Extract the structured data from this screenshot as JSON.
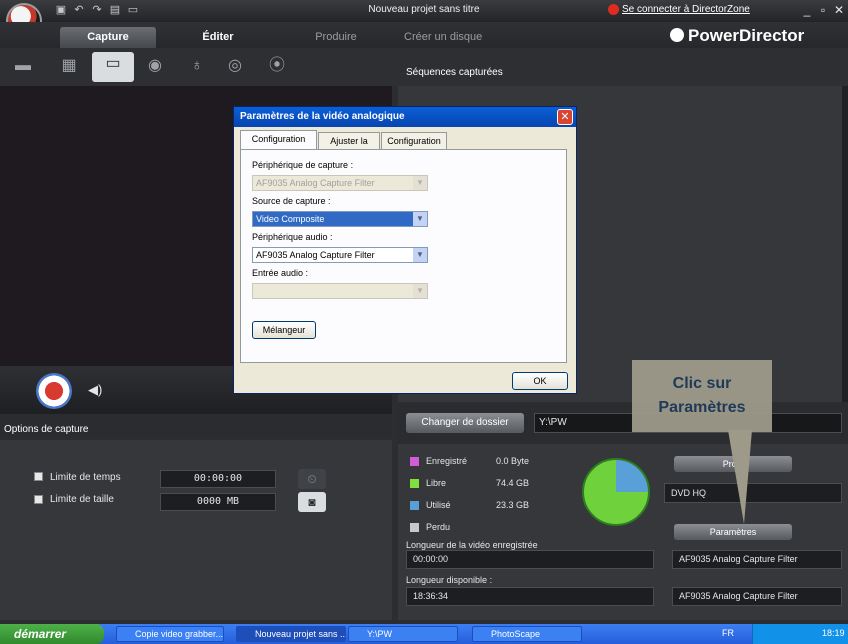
{
  "titlebar": {
    "title": "Nouveau projet sans titre",
    "directorzone_link": "Se connecter à DirectorZone"
  },
  "tabs": {
    "capture": "Capture",
    "edit": "Éditer",
    "produce": "Produire",
    "disc": "Créer un disque"
  },
  "brand": "PowerDirector",
  "panels": {
    "sequences_label": "Séquences capturées",
    "options_label": "Options de capture"
  },
  "options": {
    "time_limit_label": "Limite de temps",
    "time_limit_value": "00:00:00",
    "size_limit_label": "Limite de taille",
    "size_limit_value": "0000  MB"
  },
  "folder": {
    "change_button": "Changer de dossier",
    "path": "Y:\\PW"
  },
  "disk": {
    "legend": [
      {
        "label": "Enregistré",
        "value": "0.0 Byte",
        "color": "#d05cd8"
      },
      {
        "label": "Libre",
        "value": "74.4  GB",
        "color": "#7fe040"
      },
      {
        "label": "Utilisé",
        "value": "23.3  GB",
        "color": "#5aa0d8"
      },
      {
        "label": "Perdu",
        "value": "",
        "color": "#c8c8c8"
      }
    ],
    "recorded_length_label": "Longueur de la vidéo enregistrée",
    "recorded_length_value": "00:00:00",
    "available_length_label": "Longueur disponible :",
    "available_length_value": "18:36:34"
  },
  "profile": {
    "button": "Profil",
    "value": "DVD HQ",
    "params_button": "Paramètres",
    "device_video": "AF9035 Analog Capture Filter",
    "device_audio": "AF9035 Analog Capture Filter"
  },
  "callout": {
    "line1": "Clic sur",
    "line2": "Paramètres"
  },
  "dialog": {
    "title": "Paramètres de la vidéo analogique",
    "tabs": [
      "Configuration vidéo",
      "Ajuster la vidéo",
      "Configuration TV"
    ],
    "capture_device_label": "Périphérique de capture :",
    "capture_device_value": "AF9035 Analog Capture Filter",
    "capture_source_label": "Source de capture :",
    "capture_source_value": "Video Composite",
    "audio_device_label": "Périphérique audio :",
    "audio_device_value": "AF9035 Analog Capture Filter",
    "audio_input_label": "Entrée audio :",
    "audio_input_value": "",
    "mixer_button": "Mélangeur",
    "ok_button": "OK"
  },
  "taskbar": {
    "start": "démarrer",
    "tasks": [
      "Copie video grabber....",
      "Nouveau projet sans ...",
      "Y:\\PW",
      "PhotoScape"
    ],
    "lang": "FR",
    "time": "18:19"
  }
}
